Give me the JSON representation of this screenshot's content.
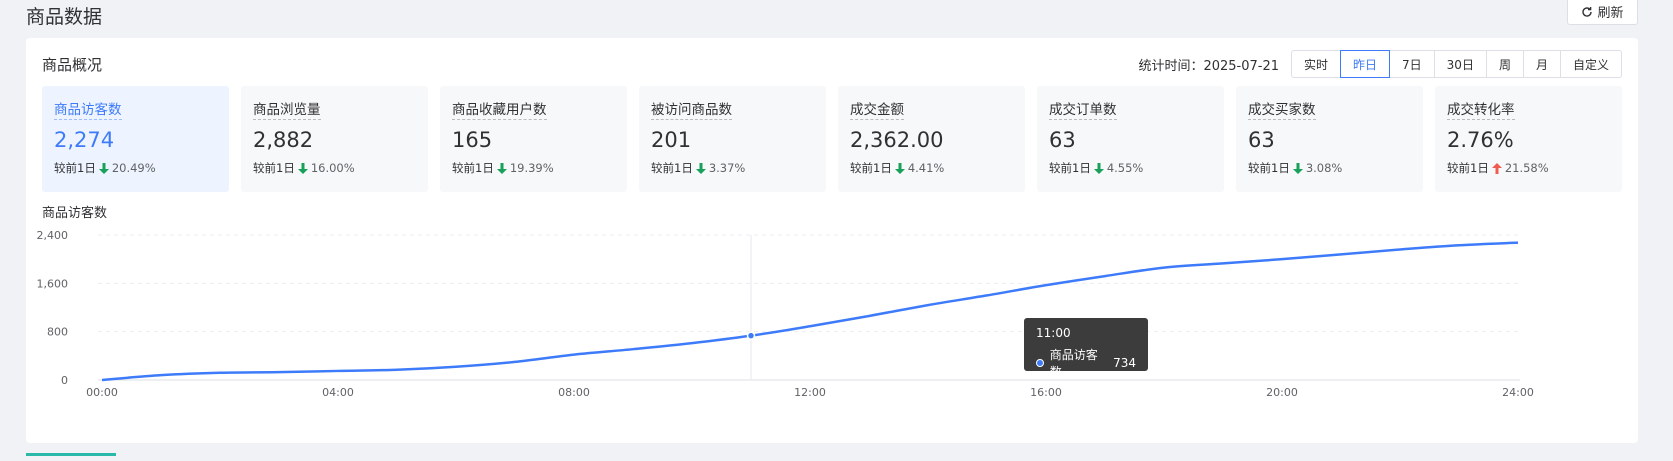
{
  "page": {
    "title": "商品数据",
    "refresh_label": "刷新"
  },
  "overview": {
    "title": "商品概况",
    "stat_time_label": "统计时间：2025-07-21",
    "ranges": [
      "实时",
      "昨日",
      "7日",
      "30日",
      "周",
      "月",
      "自定义"
    ],
    "active_range": "昨日"
  },
  "metrics": [
    {
      "name": "商品访客数",
      "value": "2,274",
      "compare_label": "较前1日",
      "direction": "down",
      "change": "20.49%",
      "active": true
    },
    {
      "name": "商品浏览量",
      "value": "2,882",
      "compare_label": "较前1日",
      "direction": "down",
      "change": "16.00%"
    },
    {
      "name": "商品收藏用户数",
      "value": "165",
      "compare_label": "较前1日",
      "direction": "down",
      "change": "19.39%"
    },
    {
      "name": "被访问商品数",
      "value": "201",
      "compare_label": "较前1日",
      "direction": "down",
      "change": "3.37%"
    },
    {
      "name": "成交金额",
      "value": "2,362.00",
      "compare_label": "较前1日",
      "direction": "down",
      "change": "4.41%"
    },
    {
      "name": "成交订单数",
      "value": "63",
      "compare_label": "较前1日",
      "direction": "down",
      "change": "4.55%"
    },
    {
      "name": "成交买家数",
      "value": "63",
      "compare_label": "较前1日",
      "direction": "down",
      "change": "3.08%"
    },
    {
      "name": "成交转化率",
      "value": "2.76%",
      "compare_label": "较前1日",
      "direction": "up",
      "change": "21.58%"
    }
  ],
  "colors": {
    "accent": "#3e7bfa",
    "down": "#19a05a",
    "up": "#f05b4f",
    "tooltip_bg": "#323232"
  },
  "chart_title": "商品访客数",
  "chart_data": {
    "type": "line",
    "x": [
      "00:00",
      "01:00",
      "02:00",
      "03:00",
      "04:00",
      "05:00",
      "06:00",
      "07:00",
      "08:00",
      "09:00",
      "10:00",
      "11:00",
      "12:00",
      "13:00",
      "14:00",
      "15:00",
      "16:00",
      "17:00",
      "18:00",
      "19:00",
      "20:00",
      "21:00",
      "22:00",
      "23:00",
      "24:00"
    ],
    "x_ticks": [
      "00:00",
      "04:00",
      "08:00",
      "12:00",
      "16:00",
      "20:00",
      "24:00"
    ],
    "series": [
      {
        "name": "商品访客数",
        "values": [
          0,
          80,
          120,
          130,
          150,
          170,
          220,
          300,
          420,
          510,
          610,
          734,
          890,
          1060,
          1240,
          1400,
          1570,
          1720,
          1860,
          1930,
          2000,
          2080,
          2160,
          2230,
          2274
        ]
      }
    ],
    "ylim": [
      0,
      2400
    ],
    "y_ticks": [
      0,
      800,
      1600,
      2400
    ],
    "y_tick_labels": [
      "0",
      "800",
      "1,600",
      "2,400"
    ],
    "grid": true,
    "tooltip": {
      "x_label": "11:00",
      "series_name": "商品访客数",
      "value": "734",
      "index": 11
    }
  }
}
